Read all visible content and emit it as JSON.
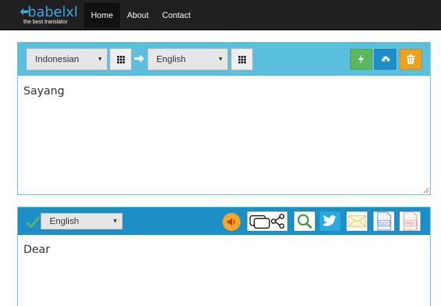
{
  "nav": {
    "logo_text": "babelxl",
    "logo_tagline": "the best translator",
    "items": [
      {
        "label": "Home",
        "active": true
      },
      {
        "label": "About",
        "active": false
      },
      {
        "label": "Contact",
        "active": false
      }
    ]
  },
  "source": {
    "from_language": "Indonesian",
    "to_language": "English",
    "text": "Sayang",
    "icons": {
      "from_grid": "grid-icon",
      "swap": "arrow-right-icon",
      "to_grid": "grid-icon",
      "translate": "flash-icon",
      "upload": "cloud-upload-icon",
      "clear": "trash-icon"
    },
    "colors": {
      "bar": "#5bc0de",
      "translate_button": "#5cb85c",
      "upload_button": "#1e8fc6",
      "clear_button": "#f0a21c"
    }
  },
  "output": {
    "language": "English",
    "text": "Dear",
    "icons": {
      "status": "checkmark-icon",
      "listen": "speaker-icon",
      "share": "chat-share-icon",
      "search": "magnifier-icon",
      "twitter": "twitter-icon",
      "email": "envelope-icon",
      "doc": "doc-file-icon",
      "pdf": "pdf-file-icon"
    },
    "colors": {
      "bar": "#1e8fc6",
      "listen_button": "#f5a623"
    }
  }
}
